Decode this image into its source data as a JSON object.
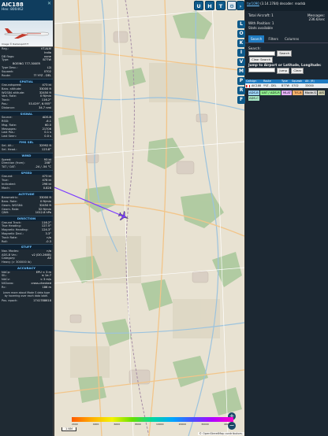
{
  "info": {
    "callsign": "AIC188",
    "hex_label": "Hex: 800462",
    "photo_credit": "Image © Radarspot???",
    "rows_top": [
      {
        "k": "Reg.:",
        "v": "VT-ALM"
      },
      {
        "k": "",
        "v": "India"
      },
      {
        "k": "DB flags:",
        "v": "none"
      },
      {
        "k": "Type:",
        "v": "B77W"
      }
    ],
    "model": "BOEING 777-300ER",
    "rows_type": [
      {
        "k": "Type Desc.:",
        "v": "L2J"
      },
      {
        "k": "Squawk:",
        "v": "0702"
      },
      {
        "k": "Route:",
        "v": "?? YYZ - DEL"
      }
    ],
    "sections": [
      {
        "title": "SPATIAL",
        "rows": [
          {
            "k": "Groundspeed:",
            "v": "473 kt"
          },
          {
            "k": "Baro. altitude:",
            "v": "33000 ft"
          },
          {
            "k": "WGS84 altitude:",
            "v": "32450 ft"
          },
          {
            "k": "Vert. Rate:",
            "v": "0 ft/min"
          },
          {
            "k": "Track:",
            "v": "116.2°"
          },
          {
            "k": "Pos.:",
            "v": "53.029°, 6.955°"
          },
          {
            "k": "Distance:",
            "v": "34.7 nmi"
          }
        ]
      },
      {
        "title": "SIGNAL",
        "rows": [
          {
            "k": "Source:",
            "v": "ADS-B"
          },
          {
            "k": "RSSI:",
            "v": "-6.1"
          },
          {
            "k": "Msg. Rate:",
            "v": "60.0"
          },
          {
            "k": "Messages:",
            "v": "21706"
          },
          {
            "k": "Last Pos.:",
            "v": "0.1 s"
          },
          {
            "k": "Last Seen:",
            "v": "0.0 s"
          }
        ]
      },
      {
        "title": "FMS SEL",
        "rows": [
          {
            "k": "Sel. Alt.:",
            "v": "32992 ft"
          },
          {
            "k": "Sel. Head.:",
            "v": "123.8°"
          }
        ]
      },
      {
        "title": "WIND",
        "rows": [
          {
            "k": "Speed:",
            "v": "93 kt"
          },
          {
            "k": "Direction (from):",
            "v": "208°"
          },
          {
            "k": "TAT / OAT:",
            "v": "-24 / -54 °C"
          }
        ]
      },
      {
        "title": "SPEED",
        "rows": [
          {
            "k": "Ground:",
            "v": "473 kt"
          },
          {
            "k": "True:",
            "v": "478 kt"
          },
          {
            "k": "Indicated:",
            "v": "296 kt"
          },
          {
            "k": "Mach:",
            "v": "0.828"
          }
        ]
      },
      {
        "title": "ALTITUDE",
        "rows": [
          {
            "k": "Barometric:",
            "v": "33000 ft"
          },
          {
            "k": "Baro. Rate:",
            "v": "0 ft/min"
          },
          {
            "k": "Geom. WGS84:",
            "v": "32450 ft"
          },
          {
            "k": "Geom. Rate:",
            "v": "32 ft/min"
          },
          {
            "k": "QNH:",
            "v": "1012.8 hPa"
          }
        ]
      },
      {
        "title": "DIRECTION",
        "rows": [
          {
            "k": "Ground Track:",
            "v": "116.2°"
          },
          {
            "k": "True Heading:",
            "v": "127.5°"
          },
          {
            "k": "Magnetic Heading:",
            "v": "124.3°"
          },
          {
            "k": "Magnetic Decl.:",
            "v": "3.3°"
          },
          {
            "k": "Track Rate:",
            "v": "n/a"
          },
          {
            "k": "Roll:",
            "v": "-0.3"
          }
        ]
      },
      {
        "title": "STUFF",
        "rows": [
          {
            "k": "Nav. Modes:",
            "v": "n/a"
          },
          {
            "k": "ADS-B Ver.:",
            "v": "v2 (DO-260B)"
          },
          {
            "k": "Category:",
            "v": "A5"
          },
          {
            "k": "Heavy (> 300000 lb)",
            "v": ""
          }
        ]
      },
      {
        "title": "ACCURACY",
        "rows": [
          {
            "k": "NACp:",
            "v": "EPU < 3 m"
          },
          {
            "k": "SIL:",
            "v": "≤ 1e-7"
          },
          {
            "k": "NACv:",
            "v": "< 3 m/s"
          },
          {
            "k": "NICbaro:",
            "v": "cross-checked"
          },
          {
            "k": "Rc:",
            "v": "186 m"
          }
        ]
      }
    ],
    "note": "Learn more about Mode S data type by hovering over each data label.",
    "pos_epoch": {
      "k": "Pos. epoch:",
      "v": "1741788618"
    }
  },
  "map": {
    "top_buttons": [
      "U",
      "H",
      "T"
    ],
    "zoom_plus": "+",
    "zoom_minus": "−",
    "scale_label": "1 NM",
    "alt_labels": [
      "2000",
      "4000",
      "6000",
      "8000",
      "10000",
      "20000",
      "30000",
      "40000+"
    ],
    "attribution": "© OpenStreetMap contributors."
  },
  "strip_buttons": [
    "L",
    "O",
    "K",
    "I",
    "V",
    "M",
    "P",
    "R",
    "F"
  ],
  "panel": {
    "version_link": "tar1090",
    "version_text": "(3.14.1784) decoder: readsb",
    "total_label": "Total Aircraft: 1",
    "messages_label": "Messages:",
    "messages_value": "236.6/sec",
    "with_position": "With Position: 1",
    "stats": "Stats available",
    "tabs": [
      "Search",
      "Filters",
      "Columns"
    ],
    "search_label": "Search:",
    "search_button": "Search",
    "clear_search": "Clear Search",
    "jump_label": "Jump to Airport or Latitude, Longitude:",
    "jump_button": "Jump",
    "clear_button": "Clear",
    "columns": [
      "Callsign",
      "Route",
      "Type",
      "Squawk",
      "Alt. (ft)"
    ],
    "row": [
      "AIC188",
      "YYZ - DEL",
      "B77W",
      "0702",
      "33000"
    ],
    "legend": [
      {
        "label": "ADS-B",
        "color": "#9fd7ff"
      },
      {
        "label": "UAT / ADS-R",
        "color": "#90ee90"
      },
      {
        "label": "MLAT",
        "color": "#e6b3ff"
      },
      {
        "label": "TIS-B",
        "color": "#ffb36b"
      },
      {
        "label": "Mode-S",
        "color": "#d0d0d0"
      },
      {
        "label": "AIS",
        "color": "#c8c8a8"
      },
      {
        "label": "ADS-C",
        "color": "#a8e8c8"
      }
    ]
  }
}
